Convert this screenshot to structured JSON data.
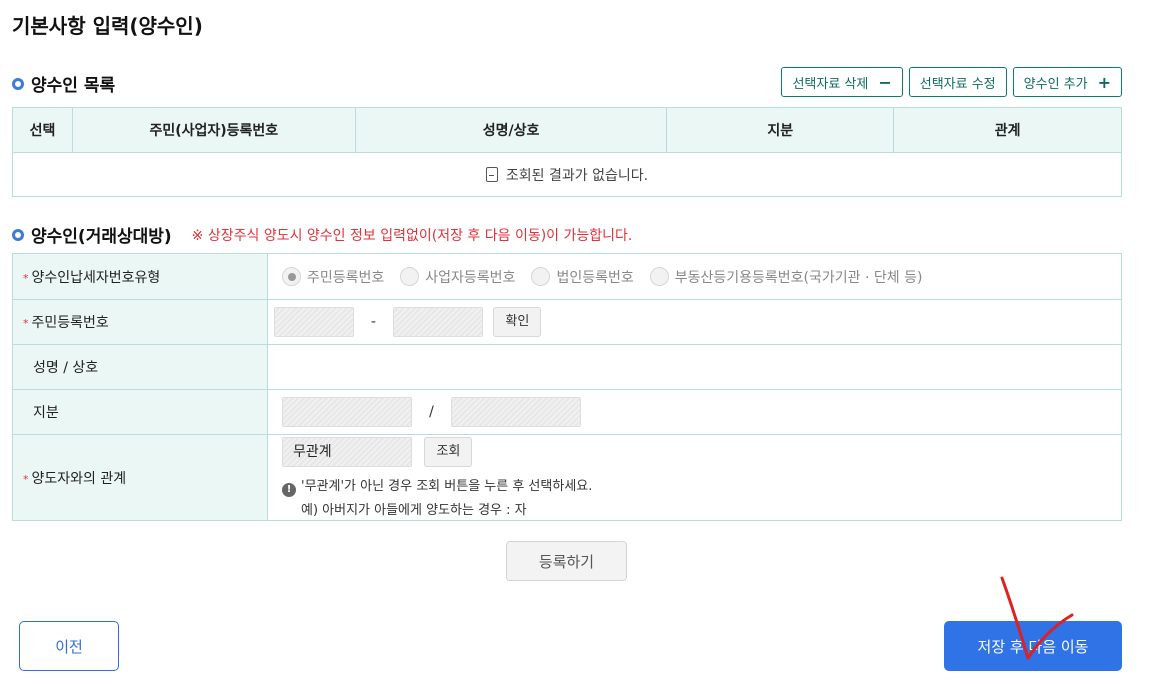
{
  "page": {
    "title": "기본사항 입력(양수인)"
  },
  "list_section": {
    "title": "양수인 목록",
    "buttons": {
      "delete_label": "선택자료 삭제",
      "delete_symbol": "−",
      "edit_label": "선택자료 수정",
      "add_label": "양수인 추가",
      "add_symbol": "+"
    },
    "columns": [
      "선택",
      "주민(사업자)등록번호",
      "성명/상호",
      "지분",
      "관계"
    ],
    "empty_message": "조회된 결과가 없습니다."
  },
  "form_section": {
    "title": "양수인(거래상대방)",
    "note": "※ 상장주식 양도시 양수인 정보 입력없이(저장 후 다음 이동)이 가능합니다.",
    "required_mark": "*",
    "rows": {
      "tax_type": {
        "label": "양수인납세자번호유형",
        "options": [
          "주민등록번호",
          "사업자등록번호",
          "법인등록번호",
          "부동산등기용등록번호(국가기관 · 단체 등)"
        ],
        "selected": "주민등록번호"
      },
      "resident_no": {
        "label": "주민등록번호",
        "separator": "-",
        "confirm_label": "확인"
      },
      "name": {
        "label": "성명 / 상호"
      },
      "share": {
        "label": "지분",
        "separator": "/"
      },
      "relation": {
        "label": "양도자와의 관계",
        "value": "무관계",
        "search_label": "조회",
        "info_icon": "!",
        "info_line1": "'무관계'가 아닌 경우 조회 버튼을 누른 후 선택하세요.",
        "info_line2": "예) 아버지가 아들에게 양도하는 경우 : 자"
      }
    }
  },
  "actions": {
    "register_label": "등록하기",
    "prev_label": "이전",
    "next_label": "저장 후 다음 이동"
  },
  "colors": {
    "accent": "#2f73e6",
    "teal": "#0f7a6e",
    "header_bg": "#eaf7f5",
    "warning": "#e0323a",
    "annotation": "#e02020"
  }
}
